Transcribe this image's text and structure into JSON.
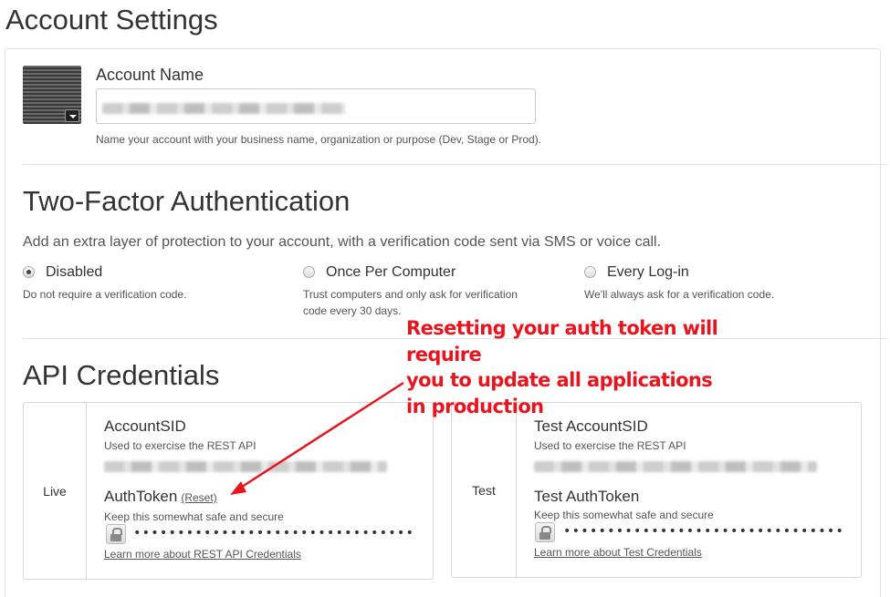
{
  "page": {
    "title": "Account Settings"
  },
  "account": {
    "name_label": "Account Name",
    "name_help": "Name your account with your business name, organization or purpose (Dev, Stage or Prod)."
  },
  "two_factor": {
    "title": "Two-Factor Authentication",
    "description": "Add an extra layer of protection to your account, with a verification code sent via SMS or voice call.",
    "options": [
      {
        "label": "Disabled",
        "help": "Do not require a verification code.",
        "selected": true
      },
      {
        "label": "Once Per Computer",
        "help": "Trust computers and only ask for verification code every 30 days.",
        "selected": false
      },
      {
        "label": "Every Log-in",
        "help": "We'll always ask for a verification code.",
        "selected": false
      }
    ]
  },
  "annotation": {
    "lines": [
      "Resetting your auth token will require",
      "you to update all applications",
      "in production"
    ],
    "color": "#e8141e"
  },
  "api": {
    "title": "API Credentials",
    "live": {
      "side_label": "Live",
      "sid_title": "AccountSID",
      "sid_help": "Used to exercise the REST API",
      "token_title": "AuthToken",
      "reset_label": "(Reset)",
      "token_help": "Keep this somewhat safe and secure",
      "token_masked": "••••••••••••••••••••••••••••••••",
      "learn_more": "Learn more about REST API Credentials"
    },
    "test": {
      "side_label": "Test",
      "sid_title": "Test AccountSID",
      "sid_help": "Used to exercise the REST API",
      "token_title": "Test AuthToken",
      "token_help": "Keep this somewhat safe and secure",
      "token_masked": "••••••••••••••••••••••••••••••••",
      "learn_more": "Learn more about Test Credentials"
    }
  },
  "icons": {
    "avatar": "account-avatar",
    "lock": "lock-icon",
    "caret": "caret-down-icon"
  }
}
